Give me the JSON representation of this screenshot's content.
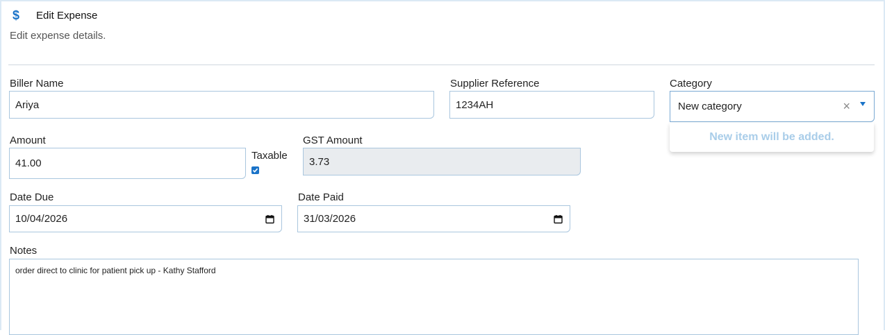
{
  "header": {
    "icon": "dollar-icon",
    "title": "Edit Expense",
    "subtitle": "Edit expense details."
  },
  "form": {
    "biller_name": {
      "label": "Biller Name",
      "value": "Ariya"
    },
    "supplier_reference": {
      "label": "Supplier Reference",
      "value": "1234AH"
    },
    "category": {
      "label": "Category",
      "value": "New category",
      "dropdown_message": "New item will be added."
    },
    "amount": {
      "label": "Amount",
      "value": "41.00"
    },
    "taxable": {
      "label": "Taxable",
      "checked": true
    },
    "gst_amount": {
      "label": "GST Amount",
      "value": "3.73"
    },
    "date_due": {
      "label": "Date Due",
      "value": "10/04/2026"
    },
    "date_paid": {
      "label": "Date Paid",
      "value": "31/03/2026"
    },
    "notes": {
      "label": "Notes",
      "value": "order direct to clinic for patient pick up - Kathy Stafford"
    }
  },
  "colors": {
    "accent": "#1a73c8",
    "input_border": "#a9c6de",
    "readonly_bg": "#e9ecef",
    "dropdown_message": "#a9cde9"
  }
}
